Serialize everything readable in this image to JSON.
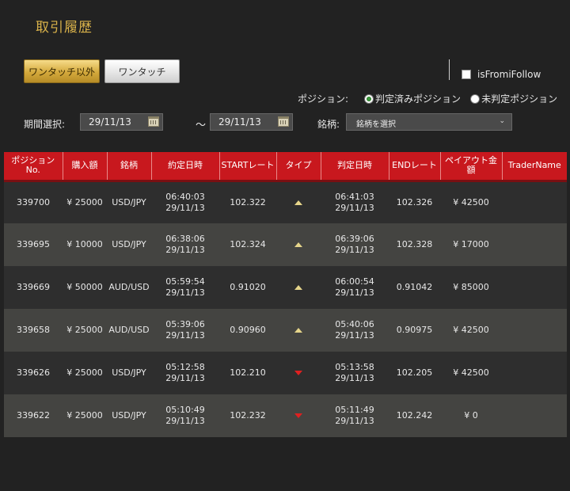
{
  "header": {
    "title": "取引履歴"
  },
  "mode_tabs": {
    "active": "ワンタッチ以外",
    "inactive": "ワンタッチ"
  },
  "follow": {
    "label": "isFromiFollow"
  },
  "position_filter": {
    "label": "ポジション:",
    "options": [
      "判定済みポジション",
      "未判定ポジション"
    ],
    "selected": "判定済みポジション"
  },
  "period": {
    "label": "期間選択:",
    "from": "29/11/13",
    "separator": "〜",
    "to": "29/11/13"
  },
  "pair_filter": {
    "label": "銘柄:",
    "value": "銘柄を選択"
  },
  "table": {
    "headers": [
      "ポジション No.",
      "購入額",
      "銘柄",
      "約定日時",
      "STARTレート",
      "タイプ",
      "判定日時",
      "ENDレート",
      "ペイアウト金額",
      "TraderName"
    ],
    "rows": [
      {
        "position_no": "339700",
        "amount": "¥ 25000",
        "pair": "USD/JPY",
        "entry_time": "06:40:03",
        "entry_date": "29/11/13",
        "start_rate": "102.322",
        "type": "up",
        "judge_time": "06:41:03",
        "judge_date": "29/11/13",
        "end_rate": "102.326",
        "payout": "¥ 42500",
        "trader": ""
      },
      {
        "position_no": "339695",
        "amount": "¥ 10000",
        "pair": "USD/JPY",
        "entry_time": "06:38:06",
        "entry_date": "29/11/13",
        "start_rate": "102.324",
        "type": "up",
        "judge_time": "06:39:06",
        "judge_date": "29/11/13",
        "end_rate": "102.328",
        "payout": "¥ 17000",
        "trader": ""
      },
      {
        "position_no": "339669",
        "amount": "¥ 50000",
        "pair": "AUD/USD",
        "entry_time": "05:59:54",
        "entry_date": "29/11/13",
        "start_rate": "0.91020",
        "type": "up",
        "judge_time": "06:00:54",
        "judge_date": "29/11/13",
        "end_rate": "0.91042",
        "payout": "¥ 85000",
        "trader": ""
      },
      {
        "position_no": "339658",
        "amount": "¥ 25000",
        "pair": "AUD/USD",
        "entry_time": "05:39:06",
        "entry_date": "29/11/13",
        "start_rate": "0.90960",
        "type": "up",
        "judge_time": "05:40:06",
        "judge_date": "29/11/13",
        "end_rate": "0.90975",
        "payout": "¥ 42500",
        "trader": ""
      },
      {
        "position_no": "339626",
        "amount": "¥ 25000",
        "pair": "USD/JPY",
        "entry_time": "05:12:58",
        "entry_date": "29/11/13",
        "start_rate": "102.210",
        "type": "down",
        "judge_time": "05:13:58",
        "judge_date": "29/11/13",
        "end_rate": "102.205",
        "payout": "¥ 42500",
        "trader": ""
      },
      {
        "position_no": "339622",
        "amount": "¥ 25000",
        "pair": "USD/JPY",
        "entry_time": "05:10:49",
        "entry_date": "29/11/13",
        "start_rate": "102.232",
        "type": "down",
        "judge_time": "05:11:49",
        "judge_date": "29/11/13",
        "end_rate": "102.242",
        "payout": "¥ 0",
        "trader": ""
      }
    ]
  }
}
